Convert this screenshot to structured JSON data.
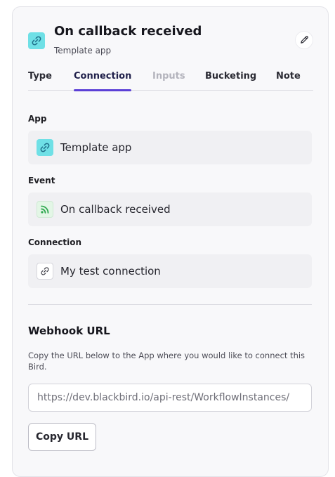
{
  "header": {
    "title": "On callback received",
    "subtitle": "Template app",
    "app_icon": "link-icon",
    "edit_icon": "pencil-icon"
  },
  "tabs": [
    {
      "label": "Type",
      "state": "normal"
    },
    {
      "label": "Connection",
      "state": "active"
    },
    {
      "label": "Inputs",
      "state": "disabled"
    },
    {
      "label": "Bucketing",
      "state": "normal"
    },
    {
      "label": "Note",
      "state": "normal"
    }
  ],
  "fields": {
    "app": {
      "label": "App",
      "value": "Template app",
      "icon": "link-icon"
    },
    "event": {
      "label": "Event",
      "value": "On callback received",
      "icon": "rss-feed-icon"
    },
    "connection": {
      "label": "Connection",
      "value": "My test connection",
      "icon": "chain-link-icon"
    }
  },
  "webhook": {
    "title": "Webhook URL",
    "description": "Copy the URL below to the App where you would like to connect this Bird.",
    "url": "https://dev.blackbird.io/api-rest/WorkflowInstances/",
    "copy_label": "Copy URL"
  },
  "colors": {
    "accent": "#5b3fd6",
    "app_icon_bg": "#6fe0e6",
    "event_icon_bg": "#e3f6e6",
    "event_icon_fg": "#2fa84f"
  }
}
